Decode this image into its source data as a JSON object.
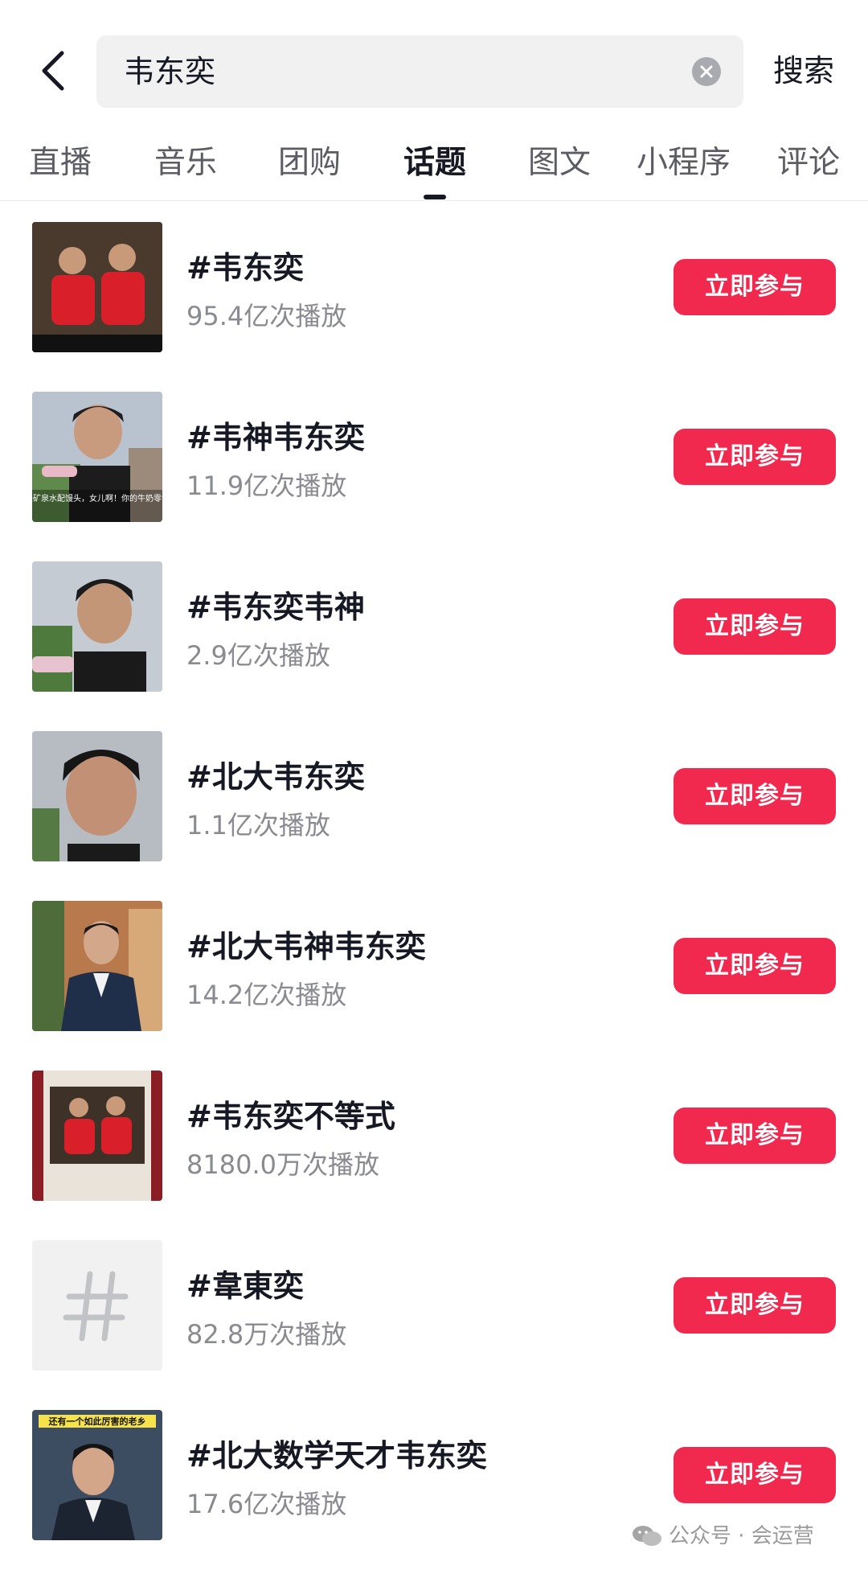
{
  "search": {
    "query": "韦东奕",
    "submit_label": "搜索"
  },
  "tabs": [
    {
      "label": "直播"
    },
    {
      "label": "音乐"
    },
    {
      "label": "团购"
    },
    {
      "label": "话题",
      "active": true
    },
    {
      "label": "图文"
    },
    {
      "label": "小程序"
    },
    {
      "label": "评论"
    }
  ],
  "topics": [
    {
      "title": "#韦东奕",
      "plays": "95.4亿次播放",
      "button": "立即参与",
      "thumb": "two-students-red-shirts"
    },
    {
      "title": "#韦神韦东奕",
      "plays": "11.9亿次播放",
      "button": "立即参与",
      "thumb": "interview-with-mic",
      "caption": "学神都是矿泉水配馒头，女儿啊！你的牛奶零食该断啦"
    },
    {
      "title": "#韦东奕韦神",
      "plays": "2.9亿次播放",
      "button": "立即参与",
      "thumb": "interview-closeup"
    },
    {
      "title": "#北大韦东奕",
      "plays": "1.1亿次播放",
      "button": "立即参与",
      "thumb": "face-closeup"
    },
    {
      "title": "#北大韦神韦东奕",
      "plays": "14.2亿次播放",
      "button": "立即参与",
      "thumb": "man-in-suit"
    },
    {
      "title": "#韦东奕不等式",
      "plays": "8180.0万次播放",
      "button": "立即参与",
      "thumb": "two-students-framed"
    },
    {
      "title": "#韋東奕",
      "plays": "82.8万次播放",
      "button": "立即参与",
      "thumb": "hashtag-placeholder"
    },
    {
      "title": "#北大数学天才韦东奕",
      "plays": "17.6亿次播放",
      "button": "立即参与",
      "thumb": "portrait-with-banner",
      "caption": "还有一个如此厉害的老乡"
    }
  ],
  "watermark": "公众号 · 会运营",
  "colors": {
    "accent": "#f2294f",
    "text_primary": "#161823",
    "text_secondary": "#8a8b91"
  }
}
